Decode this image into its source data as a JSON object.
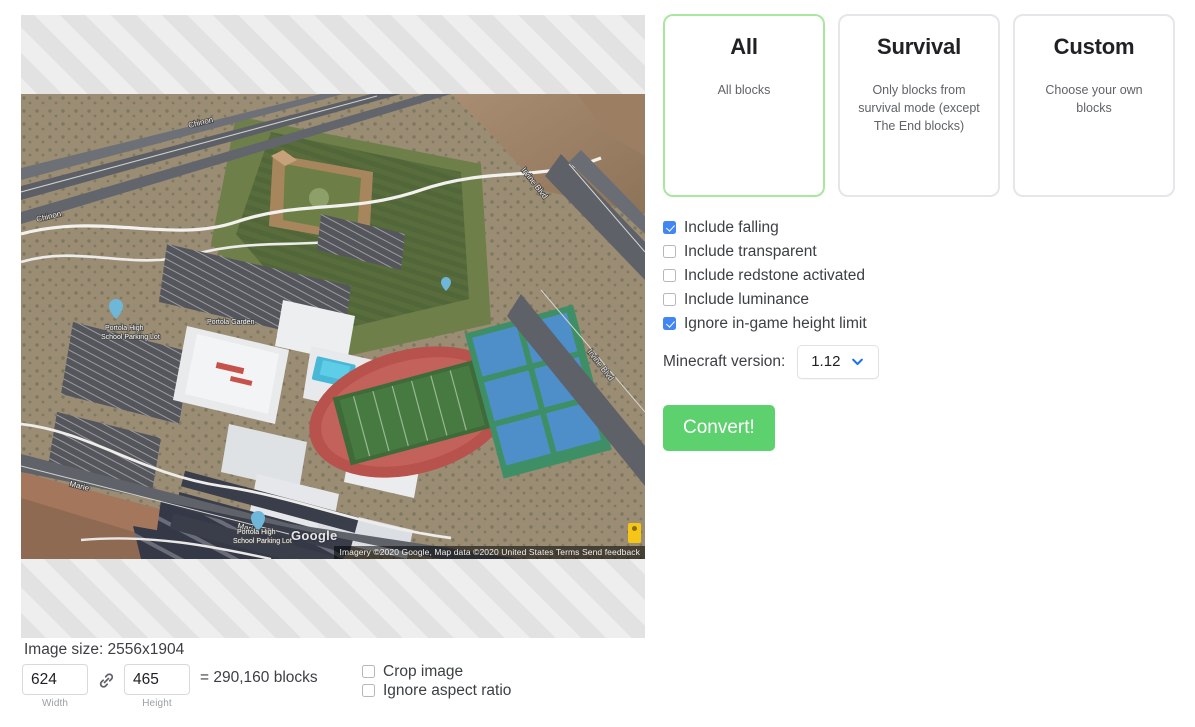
{
  "preview": {
    "image_alt": "aerial-satellite-map-school-campus",
    "google_logo": "Google",
    "attribution": "Imagery ©2020 Google, Map data ©2020   United States   Terms   Send feedback",
    "street_labels": [
      "Chinon",
      "Chinon",
      "Irvine Blvd",
      "Irvine Blvd",
      "Marie",
      "Marie"
    ],
    "place_labels": [
      "Portola High School Parking Lot",
      "Portola Garden",
      "Portola High School Parking Lot"
    ]
  },
  "bottom": {
    "image_size_text": "Image size: 2556x1904",
    "width_value": "624",
    "width_label": "Width",
    "height_value": "465",
    "height_label": "Height",
    "link_icon": "chain-link-icon",
    "blocks_text": "= 290,160 blocks",
    "options": [
      {
        "label": "Crop image",
        "checked": false
      },
      {
        "label": "Ignore aspect ratio",
        "checked": false
      }
    ]
  },
  "modes": {
    "cards": [
      {
        "title": "All",
        "desc": "All blocks",
        "selected": true
      },
      {
        "title": "Survival",
        "desc": "Only blocks from survival mode (except The End blocks)",
        "selected": false
      },
      {
        "title": "Custom",
        "desc": "Choose your own blocks",
        "selected": false
      }
    ],
    "selected_border_color": "#a8e89e"
  },
  "options": [
    {
      "label": "Include falling",
      "checked": true
    },
    {
      "label": "Include transparent",
      "checked": false
    },
    {
      "label": "Include redstone activated",
      "checked": false
    },
    {
      "label": "Include luminance",
      "checked": false
    },
    {
      "label": "Ignore in-game height limit",
      "checked": true
    }
  ],
  "version": {
    "label": "Minecraft version:",
    "value": "1.12",
    "chevron_icon": "chevron-down-icon",
    "accent_color": "#1a73e8"
  },
  "convert": {
    "label": "Convert!",
    "color": "#5cd16e"
  }
}
